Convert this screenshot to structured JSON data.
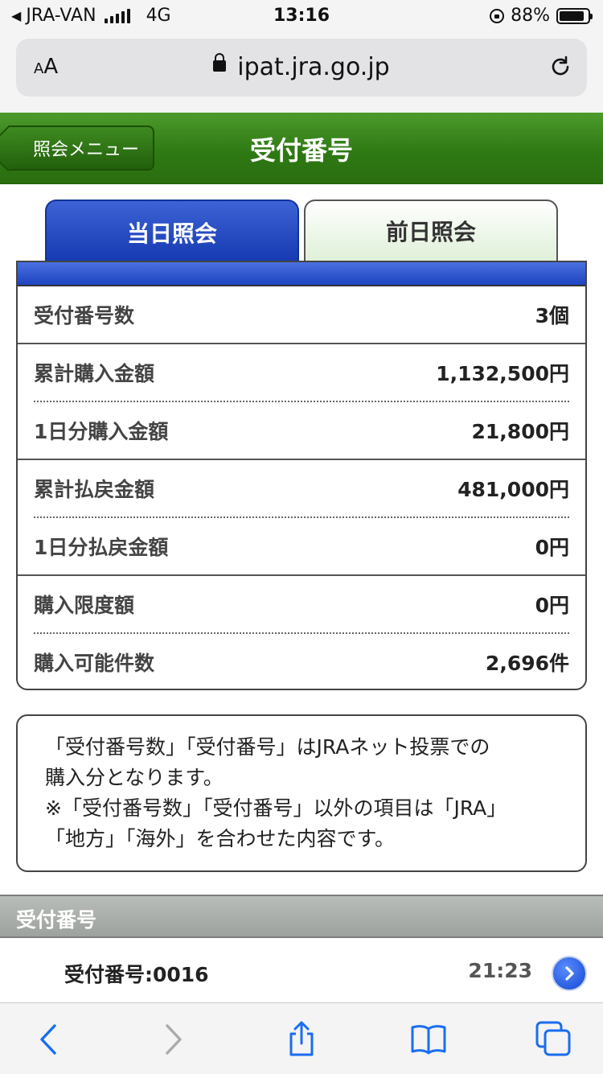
{
  "status_bar": {
    "carrier": "JRA-VAN",
    "network": "4G",
    "time": "13:16",
    "battery": "88%",
    "battery_level": 0.88
  },
  "browser": {
    "text_size_label": "AA",
    "url": "ipat.jra.go.jp"
  },
  "header": {
    "back_label": "照会メニュー",
    "title": "受付番号"
  },
  "tabs": [
    {
      "label": "当日照会",
      "active": true
    },
    {
      "label": "前日照会",
      "active": false
    }
  ],
  "summary": {
    "rows": [
      {
        "label": "受付番号数",
        "value": "3個"
      },
      {
        "label": "累計購入金額",
        "value": "1,132,500円"
      },
      {
        "label": "1日分購入金額",
        "value": "21,800円"
      },
      {
        "label": "累計払戻金額",
        "value": "481,000円"
      },
      {
        "label": "1日分払戻金額",
        "value": "0円"
      },
      {
        "label": "購入限度額",
        "value": "0円"
      },
      {
        "label": "購入可能件数",
        "value": "2,696件"
      }
    ]
  },
  "notice": {
    "line1": "「受付番号数」「受付番号」はJRAネット投票での",
    "line2": "購入分となります。",
    "line3": "※「受付番号数」「受付番号」以外の項目は「JRA」",
    "line4": "「地方」「海外」を合わせた内容です。"
  },
  "section": {
    "title": "受付番号",
    "entries": [
      {
        "number": "受付番号:0016",
        "time": "21:23"
      }
    ]
  },
  "colors": {
    "header_green": "#2f7a14",
    "tab_blue": "#1d44c0",
    "ios_blue": "#1a6df0"
  }
}
